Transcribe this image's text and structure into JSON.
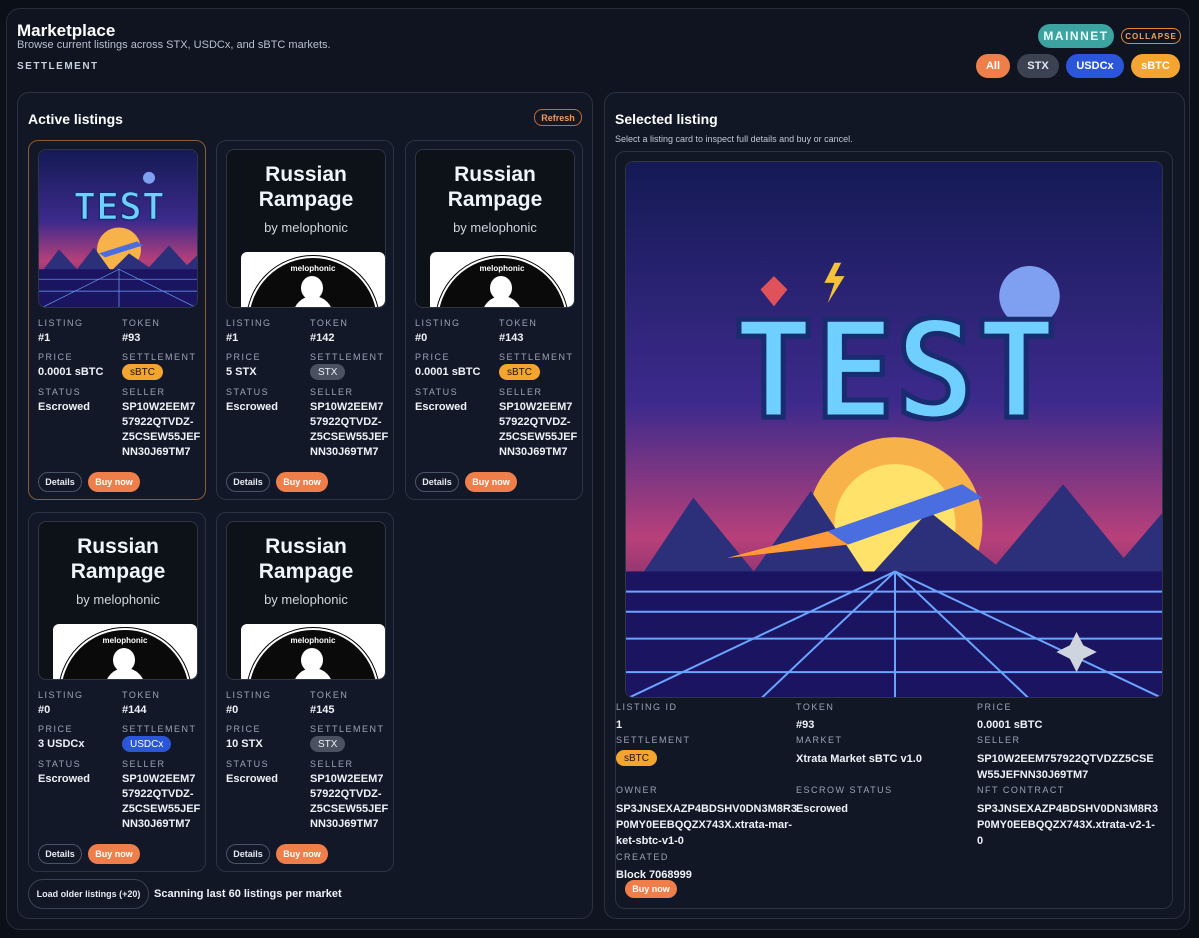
{
  "header": {
    "title": "Marketplace",
    "subtitle": "Browse current listings across STX, USDCx, and sBTC markets.",
    "settlement_label": "SETTLEMENT",
    "network": "MAINNET",
    "collapse": "COLLAPSE",
    "filters": [
      "All",
      "STX",
      "USDCx",
      "sBTC"
    ]
  },
  "listings_panel": {
    "title": "Active listings",
    "refresh": "Refresh",
    "labels": {
      "listing": "LISTING",
      "token": "TOKEN",
      "price": "PRICE",
      "settlement": "SETTLEMENT",
      "status": "STATUS",
      "seller": "SELLER"
    },
    "details_label": "Details",
    "buy_label": "Buy now",
    "cards": [
      {
        "art": "test",
        "listing": "#1",
        "token": "#93",
        "price": "0.0001 sBTC",
        "settlement": "sBTC",
        "status": "Escrowed",
        "seller": "SP10W2EEM7 57922QTVDZ- Z5CSEW55JEF NN30J69TM7"
      },
      {
        "art": "russian",
        "listing": "#1",
        "token": "#142",
        "price": "5 STX",
        "settlement": "STX",
        "status": "Escrowed",
        "seller": "SP10W2EEM7 57922QTVDZ- Z5CSEW55JEF NN30J69TM7"
      },
      {
        "art": "russian",
        "listing": "#0",
        "token": "#143",
        "price": "0.0001 sBTC",
        "settlement": "sBTC",
        "status": "Escrowed",
        "seller": "SP10W2EEM7 57922QTVDZ- Z5CSEW55JEF NN30J69TM7"
      },
      {
        "art": "russian",
        "listing": "#0",
        "token": "#144",
        "price": "3 USDCx",
        "settlement": "USDCx",
        "status": "Escrowed",
        "seller": "SP10W2EEM7 57922QTVDZ- Z5CSEW55JEF NN30J69TM7"
      },
      {
        "art": "russian",
        "listing": "#0",
        "token": "#145",
        "price": "10 STX",
        "settlement": "STX",
        "status": "Escrowed",
        "seller": "SP10W2EEM7 57922QTVDZ- Z5CSEW55JEF NN30J69TM7"
      }
    ],
    "russian_art": {
      "line1": "Russian",
      "line2": "Rampage",
      "by": "by melophonic",
      "logo": "melophonic"
    },
    "test_art": {
      "word": "TEST"
    },
    "load_older": "Load older listings (+20)",
    "scanning": "Scanning last 60 listings per market"
  },
  "selected_panel": {
    "title": "Selected listing",
    "subtitle": "Select a listing card to inspect full details and buy or cancel.",
    "fields": {
      "listing_id_label": "LISTING ID",
      "listing_id": "1",
      "token_label": "TOKEN",
      "token": "#93",
      "price_label": "PRICE",
      "price": "0.0001 sBTC",
      "settlement_label": "SETTLEMENT",
      "settlement": "sBTC",
      "market_label": "MARKET",
      "market": "Xtrata Market sBTC v1.0",
      "seller_label": "SELLER",
      "seller": "SP10W2EEM757922QTVDZZ5CSE W55JEFNN30J69TM7",
      "owner_label": "OWNER",
      "owner": "SP3JNSEXAZP4BDSHV0DN3M8R3 P0MY0EEBQQZX743X.xtrata-mar- ket-sbtc-v1-0",
      "escrow_label": "ESCROW STATUS",
      "escrow": "Escrowed",
      "nft_label": "NFT CONTRACT",
      "nft": "SP3JNSEXAZP4BDSHV0DN3M8R3 P0MY0EEBQQZX743X.xtrata-v2-1- 0",
      "created_label": "CREATED",
      "created": "Block 7068999"
    },
    "buy_label": "Buy now"
  }
}
